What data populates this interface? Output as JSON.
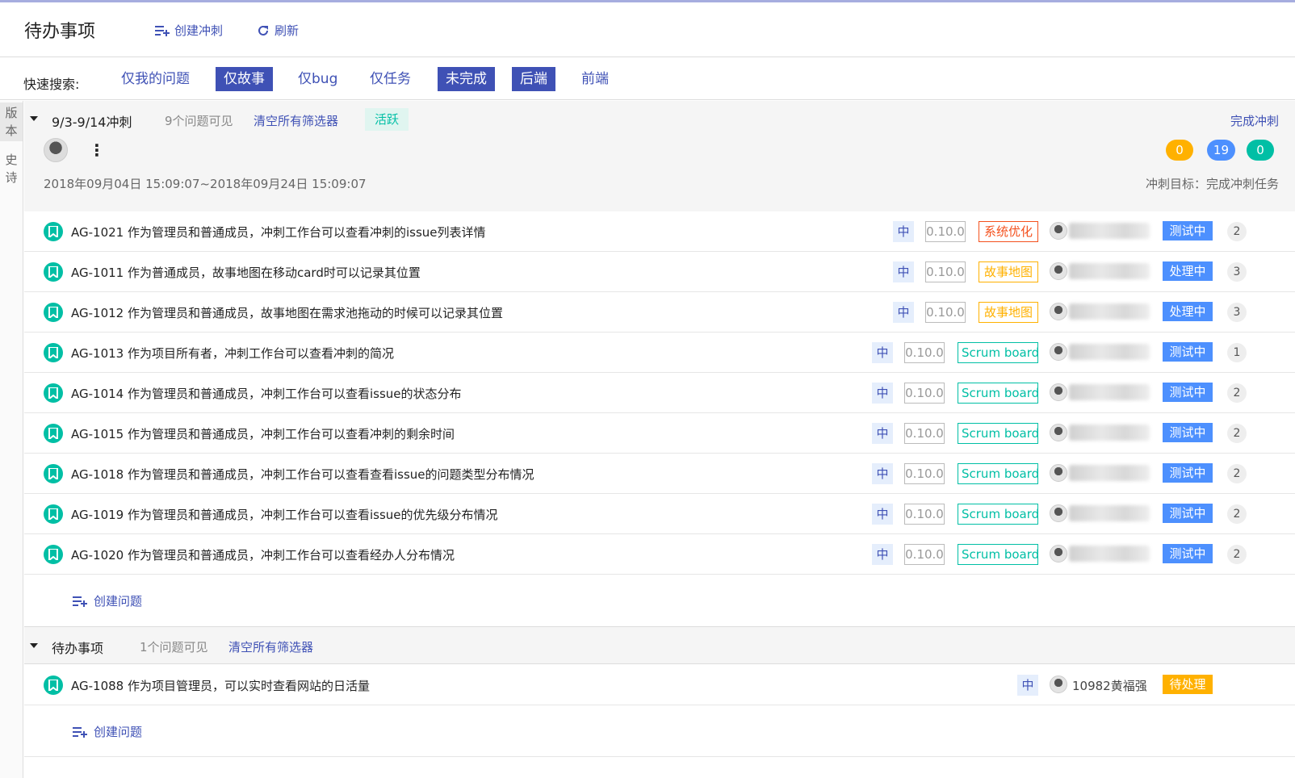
{
  "header": {
    "title": "待办事项",
    "create_sprint": "创建冲刺",
    "refresh": "刷新"
  },
  "quick_search": {
    "label": "快速搜索:",
    "filters": [
      {
        "label": "仅我的问题",
        "active": false
      },
      {
        "label": "仅故事",
        "active": true
      },
      {
        "label": "仅bug",
        "active": false
      },
      {
        "label": "仅任务",
        "active": false
      },
      {
        "label": "未完成",
        "active": true
      },
      {
        "label": "后端",
        "active": true
      },
      {
        "label": "前端",
        "active": false
      }
    ]
  },
  "side_tabs": {
    "version": "版本",
    "epic": "史诗"
  },
  "sprint": {
    "name": "9/3-9/14冲刺",
    "visible_count": "9个问题可见",
    "clear_filters": "清空所有筛选器",
    "state": "活跃",
    "complete": "完成冲刺",
    "dates": "2018年09月04日 15:09:07~2018年09月24日 15:09:07",
    "goal": "冲刺目标：完成冲刺任务",
    "counts": [
      {
        "value": "0",
        "color": "#ffb100"
      },
      {
        "value": "19",
        "color": "#4d90fe"
      },
      {
        "value": "0",
        "color": "#00bfa5"
      }
    ],
    "issues": [
      {
        "text": "AG-1021 作为管理员和普通成员，冲刺工作台可以查看冲刺的issue列表详情",
        "priority": "中",
        "version": "0.10.0",
        "epic": "系统优化",
        "epic_color": "#f4511e",
        "status": "测试中",
        "status_color": "#4d90fe",
        "points": "2"
      },
      {
        "text": "AG-1011 作为普通成员，故事地图在移动card时可以记录其位置",
        "priority": "中",
        "version": "0.10.0",
        "epic": "故事地图",
        "epic_color": "#ffb100",
        "status": "处理中",
        "status_color": "#4d90fe",
        "points": "3"
      },
      {
        "text": "AG-1012 作为管理员和普通成员，故事地图在需求池拖动的时候可以记录其位置",
        "priority": "中",
        "version": "0.10.0",
        "epic": "故事地图",
        "epic_color": "#ffb100",
        "status": "处理中",
        "status_color": "#4d90fe",
        "points": "3"
      },
      {
        "text": "AG-1013 作为项目所有者，冲刺工作台可以查看冲刺的简况",
        "priority": "中",
        "version": "0.10.0",
        "epic": "Scrum board",
        "epic_color": "#00bfa5",
        "status": "测试中",
        "status_color": "#4d90fe",
        "points": "1"
      },
      {
        "text": "AG-1014 作为管理员和普通成员，冲刺工作台可以查看issue的状态分布",
        "priority": "中",
        "version": "0.10.0",
        "epic": "Scrum board",
        "epic_color": "#00bfa5",
        "status": "测试中",
        "status_color": "#4d90fe",
        "points": "2"
      },
      {
        "text": "AG-1015 作为管理员和普通成员，冲刺工作台可以查看冲刺的剩余时间",
        "priority": "中",
        "version": "0.10.0",
        "epic": "Scrum board",
        "epic_color": "#00bfa5",
        "status": "测试中",
        "status_color": "#4d90fe",
        "points": "2"
      },
      {
        "text": "AG-1018 作为管理员和普通成员，冲刺工作台可以查看查看issue的问题类型分布情况",
        "priority": "中",
        "version": "0.10.0",
        "epic": "Scrum board",
        "epic_color": "#00bfa5",
        "status": "测试中",
        "status_color": "#4d90fe",
        "points": "2"
      },
      {
        "text": "AG-1019 作为管理员和普通成员，冲刺工作台可以查看issue的优先级分布情况",
        "priority": "中",
        "version": "0.10.0",
        "epic": "Scrum board",
        "epic_color": "#00bfa5",
        "status": "测试中",
        "status_color": "#4d90fe",
        "points": "2"
      },
      {
        "text": "AG-1020 作为管理员和普通成员，冲刺工作台可以查看经办人分布情况",
        "priority": "中",
        "version": "0.10.0",
        "epic": "Scrum board",
        "epic_color": "#00bfa5",
        "status": "测试中",
        "status_color": "#4d90fe",
        "points": "2"
      }
    ],
    "create_issue": "创建问题"
  },
  "backlog": {
    "name": "待办事项",
    "visible_count": "1个问题可见",
    "clear_filters": "清空所有筛选器",
    "issues": [
      {
        "text": "AG-1088 作为项目管理员，可以实时查看网站的日活量",
        "priority": "中",
        "assignee": "10982黄福强",
        "status": "待处理",
        "status_color": "#ffb100"
      }
    ],
    "create_issue": "创建问题"
  }
}
